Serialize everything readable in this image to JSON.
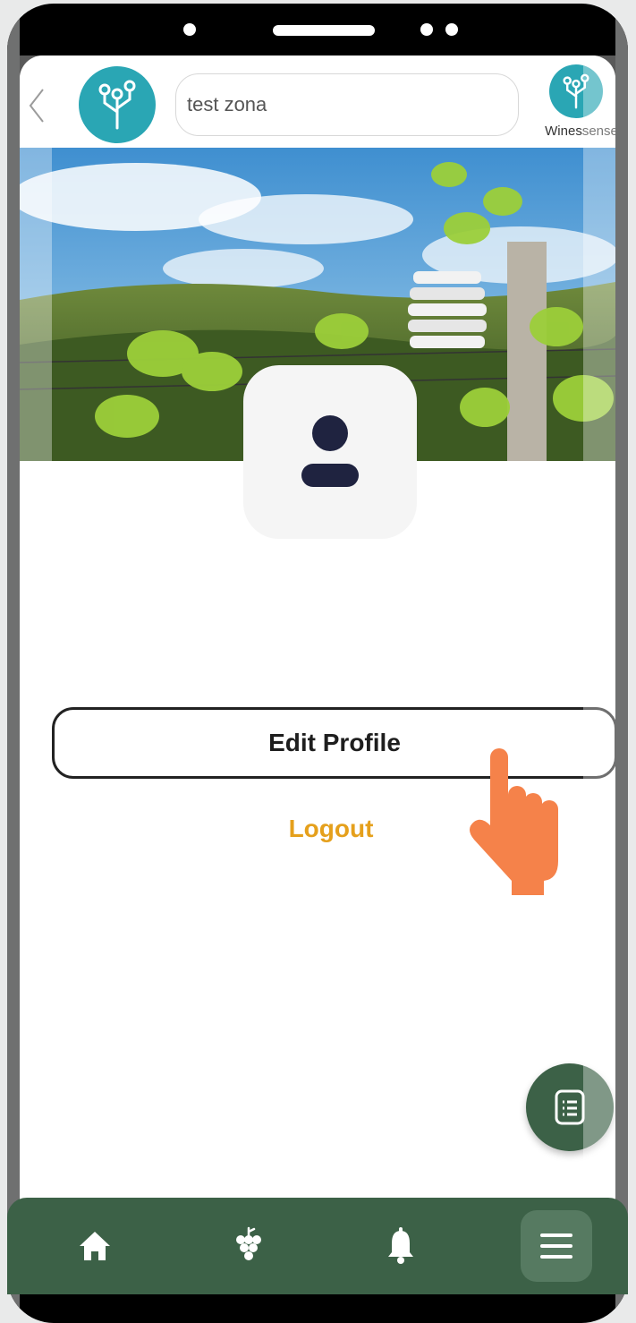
{
  "header": {
    "search_value": "test zona",
    "brand_name": "Winessense"
  },
  "profile": {
    "edit_label": "Edit Profile",
    "logout_label": "Logout"
  },
  "icons": {
    "back": "chevron-left-icon",
    "logo": "circuit-tree-icon",
    "avatar": "user-icon",
    "fab": "document-list-icon",
    "pointer": "pointing-hand-icon",
    "nav": [
      "home-icon",
      "grapes-icon",
      "bell-icon",
      "menu-icon"
    ]
  },
  "colors": {
    "accent": "#2aa6b4",
    "nav_bg": "#3c6147",
    "logout": "#e5a01c",
    "hand": "#f5824a"
  }
}
